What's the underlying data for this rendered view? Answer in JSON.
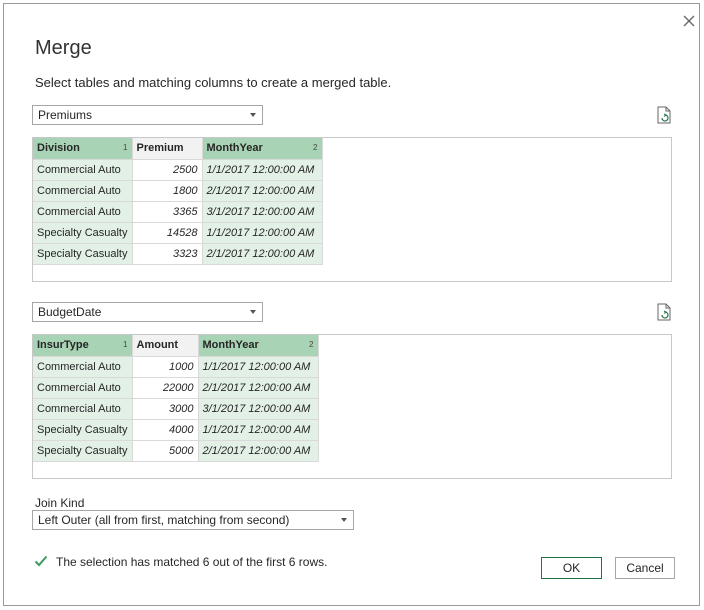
{
  "dialog": {
    "title": "Merge",
    "subtitle": "Select tables and matching columns to create a merged table."
  },
  "table1": {
    "selected": "Premiums",
    "columns": [
      {
        "name": "Division",
        "index": "1"
      },
      {
        "name": "Premium",
        "index": ""
      },
      {
        "name": "MonthYear",
        "index": "2"
      }
    ],
    "rows": [
      [
        "Commercial Auto",
        "2500",
        "1/1/2017 12:00:00 AM"
      ],
      [
        "Commercial Auto",
        "1800",
        "2/1/2017 12:00:00 AM"
      ],
      [
        "Commercial Auto",
        "3365",
        "3/1/2017 12:00:00 AM"
      ],
      [
        "Specialty Casualty",
        "14528",
        "1/1/2017 12:00:00 AM"
      ],
      [
        "Specialty Casualty",
        "3323",
        "2/1/2017 12:00:00 AM"
      ]
    ]
  },
  "table2": {
    "selected": "BudgetDate",
    "columns": [
      {
        "name": "InsurType",
        "index": "1"
      },
      {
        "name": "Amount",
        "index": ""
      },
      {
        "name": "MonthYear",
        "index": "2"
      }
    ],
    "rows": [
      [
        "Commercial Auto",
        "1000",
        "1/1/2017 12:00:00 AM"
      ],
      [
        "Commercial Auto",
        "22000",
        "2/1/2017 12:00:00 AM"
      ],
      [
        "Commercial Auto",
        "3000",
        "3/1/2017 12:00:00 AM"
      ],
      [
        "Specialty Casualty",
        "4000",
        "1/1/2017 12:00:00 AM"
      ],
      [
        "Specialty Casualty",
        "5000",
        "2/1/2017 12:00:00 AM"
      ]
    ]
  },
  "join": {
    "label": "Join Kind",
    "selected": "Left Outer (all from first, matching from second)"
  },
  "status": "The selection has matched 6 out of the first 6 rows.",
  "buttons": {
    "ok": "OK",
    "cancel": "Cancel"
  },
  "colors": {
    "accent": "#217346",
    "selected_header": "#a9d3b5",
    "selected_cell": "#e2f0e6",
    "check": "#3a9a5b"
  },
  "icons": {
    "close": "close-icon",
    "refresh": "refresh-document-icon",
    "check": "checkmark-icon",
    "dropdown": "chevron-down-icon"
  }
}
